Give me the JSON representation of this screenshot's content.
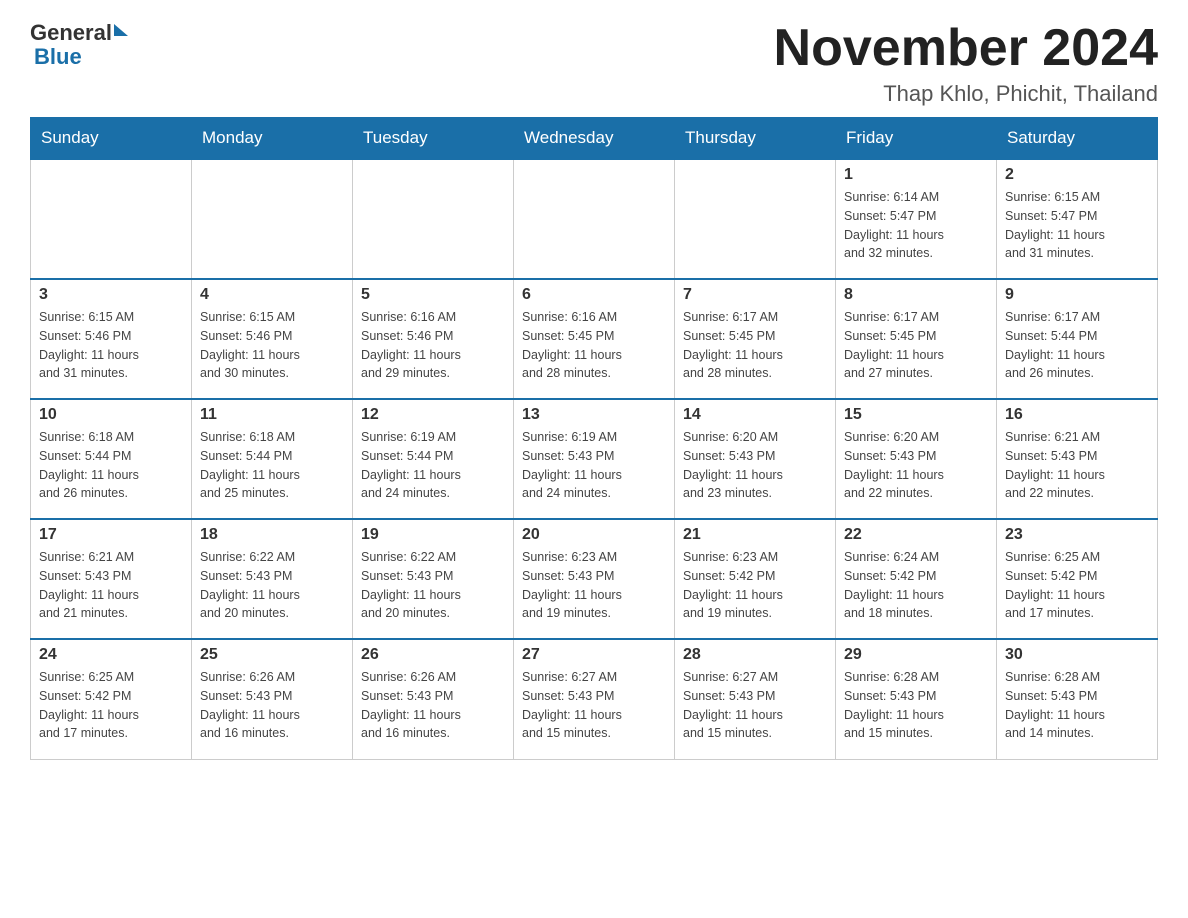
{
  "logo": {
    "general": "General",
    "blue": "Blue"
  },
  "title": "November 2024",
  "location": "Thap Khlo, Phichit, Thailand",
  "weekdays": [
    "Sunday",
    "Monday",
    "Tuesday",
    "Wednesday",
    "Thursday",
    "Friday",
    "Saturday"
  ],
  "weeks": [
    [
      {
        "day": "",
        "info": ""
      },
      {
        "day": "",
        "info": ""
      },
      {
        "day": "",
        "info": ""
      },
      {
        "day": "",
        "info": ""
      },
      {
        "day": "",
        "info": ""
      },
      {
        "day": "1",
        "info": "Sunrise: 6:14 AM\nSunset: 5:47 PM\nDaylight: 11 hours\nand 32 minutes."
      },
      {
        "day": "2",
        "info": "Sunrise: 6:15 AM\nSunset: 5:47 PM\nDaylight: 11 hours\nand 31 minutes."
      }
    ],
    [
      {
        "day": "3",
        "info": "Sunrise: 6:15 AM\nSunset: 5:46 PM\nDaylight: 11 hours\nand 31 minutes."
      },
      {
        "day": "4",
        "info": "Sunrise: 6:15 AM\nSunset: 5:46 PM\nDaylight: 11 hours\nand 30 minutes."
      },
      {
        "day": "5",
        "info": "Sunrise: 6:16 AM\nSunset: 5:46 PM\nDaylight: 11 hours\nand 29 minutes."
      },
      {
        "day": "6",
        "info": "Sunrise: 6:16 AM\nSunset: 5:45 PM\nDaylight: 11 hours\nand 28 minutes."
      },
      {
        "day": "7",
        "info": "Sunrise: 6:17 AM\nSunset: 5:45 PM\nDaylight: 11 hours\nand 28 minutes."
      },
      {
        "day": "8",
        "info": "Sunrise: 6:17 AM\nSunset: 5:45 PM\nDaylight: 11 hours\nand 27 minutes."
      },
      {
        "day": "9",
        "info": "Sunrise: 6:17 AM\nSunset: 5:44 PM\nDaylight: 11 hours\nand 26 minutes."
      }
    ],
    [
      {
        "day": "10",
        "info": "Sunrise: 6:18 AM\nSunset: 5:44 PM\nDaylight: 11 hours\nand 26 minutes."
      },
      {
        "day": "11",
        "info": "Sunrise: 6:18 AM\nSunset: 5:44 PM\nDaylight: 11 hours\nand 25 minutes."
      },
      {
        "day": "12",
        "info": "Sunrise: 6:19 AM\nSunset: 5:44 PM\nDaylight: 11 hours\nand 24 minutes."
      },
      {
        "day": "13",
        "info": "Sunrise: 6:19 AM\nSunset: 5:43 PM\nDaylight: 11 hours\nand 24 minutes."
      },
      {
        "day": "14",
        "info": "Sunrise: 6:20 AM\nSunset: 5:43 PM\nDaylight: 11 hours\nand 23 minutes."
      },
      {
        "day": "15",
        "info": "Sunrise: 6:20 AM\nSunset: 5:43 PM\nDaylight: 11 hours\nand 22 minutes."
      },
      {
        "day": "16",
        "info": "Sunrise: 6:21 AM\nSunset: 5:43 PM\nDaylight: 11 hours\nand 22 minutes."
      }
    ],
    [
      {
        "day": "17",
        "info": "Sunrise: 6:21 AM\nSunset: 5:43 PM\nDaylight: 11 hours\nand 21 minutes."
      },
      {
        "day": "18",
        "info": "Sunrise: 6:22 AM\nSunset: 5:43 PM\nDaylight: 11 hours\nand 20 minutes."
      },
      {
        "day": "19",
        "info": "Sunrise: 6:22 AM\nSunset: 5:43 PM\nDaylight: 11 hours\nand 20 minutes."
      },
      {
        "day": "20",
        "info": "Sunrise: 6:23 AM\nSunset: 5:43 PM\nDaylight: 11 hours\nand 19 minutes."
      },
      {
        "day": "21",
        "info": "Sunrise: 6:23 AM\nSunset: 5:42 PM\nDaylight: 11 hours\nand 19 minutes."
      },
      {
        "day": "22",
        "info": "Sunrise: 6:24 AM\nSunset: 5:42 PM\nDaylight: 11 hours\nand 18 minutes."
      },
      {
        "day": "23",
        "info": "Sunrise: 6:25 AM\nSunset: 5:42 PM\nDaylight: 11 hours\nand 17 minutes."
      }
    ],
    [
      {
        "day": "24",
        "info": "Sunrise: 6:25 AM\nSunset: 5:42 PM\nDaylight: 11 hours\nand 17 minutes."
      },
      {
        "day": "25",
        "info": "Sunrise: 6:26 AM\nSunset: 5:43 PM\nDaylight: 11 hours\nand 16 minutes."
      },
      {
        "day": "26",
        "info": "Sunrise: 6:26 AM\nSunset: 5:43 PM\nDaylight: 11 hours\nand 16 minutes."
      },
      {
        "day": "27",
        "info": "Sunrise: 6:27 AM\nSunset: 5:43 PM\nDaylight: 11 hours\nand 15 minutes."
      },
      {
        "day": "28",
        "info": "Sunrise: 6:27 AM\nSunset: 5:43 PM\nDaylight: 11 hours\nand 15 minutes."
      },
      {
        "day": "29",
        "info": "Sunrise: 6:28 AM\nSunset: 5:43 PM\nDaylight: 11 hours\nand 15 minutes."
      },
      {
        "day": "30",
        "info": "Sunrise: 6:28 AM\nSunset: 5:43 PM\nDaylight: 11 hours\nand 14 minutes."
      }
    ]
  ]
}
